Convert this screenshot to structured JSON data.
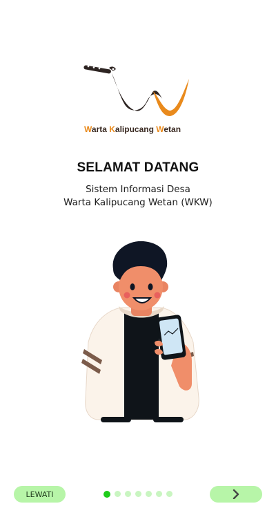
{
  "logo": {
    "name_parts": [
      "W",
      "arta ",
      "K",
      "alipucang ",
      "W",
      "etan"
    ]
  },
  "welcome": {
    "title": "SELAMAT DATANG",
    "subtitle_line1": "Sistem Informasi Desa",
    "subtitle_line2": "Warta Kalipucang Wetan (WKW)"
  },
  "navigation": {
    "skip_label": "LEWATI",
    "next_icon": "chevron-right-icon",
    "page_count": 7,
    "active_page": 1
  },
  "colors": {
    "accent_green": "#1ecc1a",
    "button_bg": "#b7f5a8",
    "logo_orange": "#e98a1c",
    "logo_dark": "#2d2422"
  }
}
